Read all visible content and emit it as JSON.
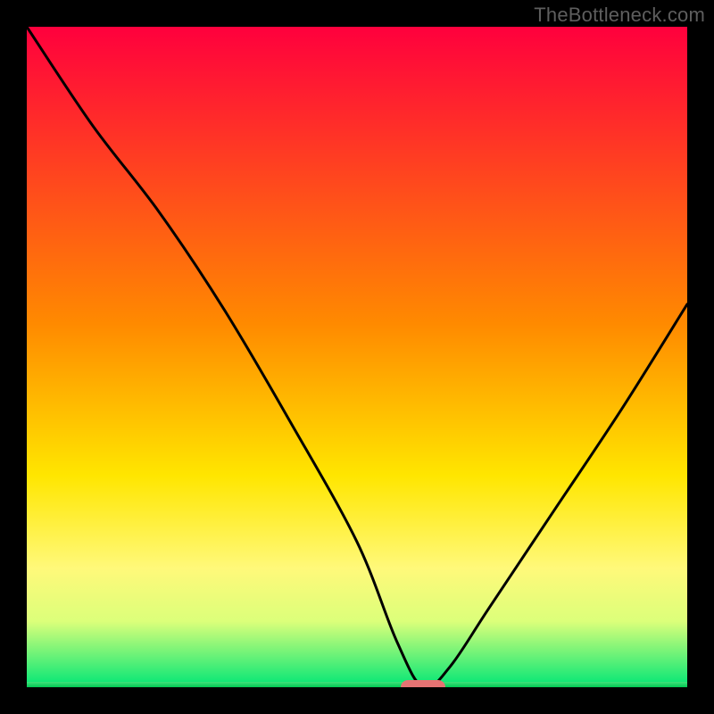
{
  "watermark": "TheBottleneck.com",
  "chart_data": {
    "type": "line",
    "title": "",
    "xlabel": "",
    "ylabel": "",
    "xlim": [
      0,
      100
    ],
    "ylim": [
      0,
      100
    ],
    "series": [
      {
        "name": "bottleneck-curve",
        "x": [
          0,
          10,
          20,
          30,
          40,
          50,
          56,
          60,
          64,
          70,
          80,
          90,
          100
        ],
        "values": [
          100,
          85,
          72,
          57,
          40,
          22,
          7,
          0,
          3,
          12,
          27,
          42,
          58
        ]
      }
    ],
    "annotations": [
      {
        "name": "optimal-marker",
        "x": 60,
        "y": 0,
        "color": "#e57373"
      }
    ],
    "background_gradient": [
      "#ff003d",
      "#ff8a00",
      "#ffe600",
      "#fff97a",
      "#dcff7a",
      "#00e676"
    ]
  }
}
